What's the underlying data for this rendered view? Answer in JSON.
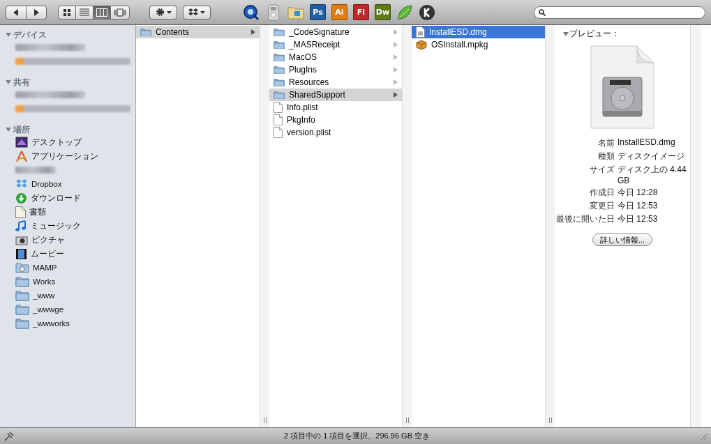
{
  "toolbar": {
    "nav": [
      {
        "kind": "back"
      },
      {
        "kind": "forward"
      }
    ],
    "views": [
      {
        "kind": "icons",
        "selected": false
      },
      {
        "kind": "list",
        "selected": false
      },
      {
        "kind": "columns",
        "selected": true
      },
      {
        "kind": "coverflow",
        "selected": false
      }
    ],
    "actions": [
      {
        "kind": "gear"
      },
      {
        "kind": "dropbox"
      }
    ],
    "apps": [
      {
        "kind": "quicktime"
      },
      {
        "kind": "remote"
      },
      {
        "kind": "folder"
      },
      {
        "kind": "badge",
        "label": "Ps",
        "color": "#1f5fa3"
      },
      {
        "kind": "badge",
        "label": "Ai",
        "color": "#e07b10"
      },
      {
        "kind": "badge",
        "label": "Fl",
        "color": "#c0282a"
      },
      {
        "kind": "badge",
        "label": "Dw",
        "color": "#5d7a16"
      },
      {
        "kind": "leaf"
      },
      {
        "kind": "k"
      }
    ]
  },
  "sidebar": [
    {
      "title": "デバイス",
      "expanded": true,
      "items": [
        {
          "kind": "blurred"
        },
        {
          "kind": "blurred-wide"
        }
      ]
    },
    {
      "title": "共有",
      "expanded": true,
      "items": [
        {
          "kind": "blurred"
        },
        {
          "kind": "blurred-wide"
        }
      ]
    },
    {
      "title": "場所",
      "expanded": true,
      "items": [
        {
          "kind": "desktop",
          "label": "デスクトップ"
        },
        {
          "kind": "apps",
          "label": "アプリケーション"
        },
        {
          "kind": "blurred-short"
        },
        {
          "kind": "dropbox",
          "label": "Dropbox"
        },
        {
          "kind": "download",
          "label": "ダウンロード"
        },
        {
          "kind": "document",
          "label": "書類"
        },
        {
          "kind": "music",
          "label": "ミュージック"
        },
        {
          "kind": "camera",
          "label": "ピクチャ"
        },
        {
          "kind": "movie",
          "label": "ムービー"
        },
        {
          "kind": "disk-folder",
          "label": "MAMP"
        },
        {
          "kind": "folder",
          "label": "Works"
        },
        {
          "kind": "folder",
          "label": "_www"
        },
        {
          "kind": "folder",
          "label": "_wwwge"
        },
        {
          "kind": "folder",
          "label": "_wwworks"
        }
      ]
    }
  ],
  "columns": [
    {
      "active": false,
      "items": [
        {
          "kind": "folder",
          "label": "Contents",
          "has_children": true,
          "selected": true
        }
      ]
    },
    {
      "active": false,
      "items": [
        {
          "kind": "folder",
          "label": "_CodeSignature",
          "has_children": true,
          "selected": false
        },
        {
          "kind": "folder",
          "label": "_MASReceipt",
          "has_children": true,
          "selected": false
        },
        {
          "kind": "folder",
          "label": "MacOS",
          "has_children": true,
          "selected": false
        },
        {
          "kind": "folder",
          "label": "PlugIns",
          "has_children": true,
          "selected": false
        },
        {
          "kind": "folder",
          "label": "Resources",
          "has_children": true,
          "selected": false
        },
        {
          "kind": "folder",
          "label": "SharedSupport",
          "has_children": true,
          "selected": true
        },
        {
          "kind": "file",
          "label": "Info.plist",
          "has_children": false,
          "selected": false
        },
        {
          "kind": "file",
          "label": "PkgInfo",
          "has_children": false,
          "selected": false
        },
        {
          "kind": "file",
          "label": "version.plist",
          "has_children": false,
          "selected": false
        }
      ]
    },
    {
      "active": true,
      "items": [
        {
          "kind": "dmg",
          "label": "InstallESD.dmg",
          "has_children": false,
          "selected": true
        },
        {
          "kind": "package",
          "label": "OSInstall.mpkg",
          "has_children": false,
          "selected": false
        }
      ]
    }
  ],
  "preview": {
    "title": "プレビュー：",
    "expanded": true,
    "fields": [
      {
        "label": "名前",
        "value": "InstallESD.dmg"
      },
      {
        "label": "種類",
        "value": "ディスクイメージ"
      },
      {
        "label": "サイズ",
        "value": "ディスク上の 4.44 GB"
      },
      {
        "label": "作成日",
        "value": "今日 12:28"
      },
      {
        "label": "変更日",
        "value": "今日 12:53"
      },
      {
        "label": "最後に開いた日",
        "value": "今日 12:53"
      }
    ],
    "button": "詳しい情報..."
  },
  "status_bar": "2 項目中の 1 項目を選択、296.96 GB 空き"
}
